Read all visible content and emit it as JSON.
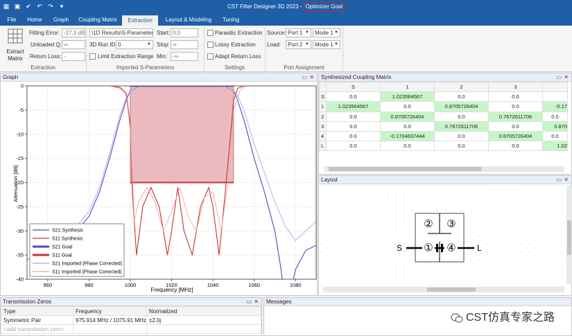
{
  "titlebar": {
    "title_main": "CST Filter Designer 3D 2023 - ",
    "title_goal": "Optimizer Goal"
  },
  "tabs": [
    "File",
    "Home",
    "Graph",
    "Coupling Matrix",
    "Extraction",
    "Layout & Modeling",
    "Tuning"
  ],
  "active_tab": "Extraction",
  "ribbon": {
    "extract_label_1": "Extract",
    "extract_label_2": "Matrix",
    "fitting_error_label": "Fitting Error:",
    "fitting_error_value": "-27.3 dB",
    "unloaded_q_label": "Unloaded Q:",
    "unloaded_q_value": "∞",
    "return_loss_label": "Return Loss:",
    "return_loss_value": "-",
    "group_extraction": "Extraction",
    "imported_path": "\\1D Results\\S-Parameters",
    "run_id_label": "3D Run ID:",
    "run_id_value": "0",
    "start_label": "Start:",
    "start_value": "0.0",
    "stop_label": "Stop:",
    "stop_value": "∞",
    "min_label": "Min:",
    "min_value": "-∞",
    "limit_range_label": "Limit Extraction Range",
    "group_imported": "Imported S-Parameters",
    "parasitic_label": "Parasitic Extraction",
    "lossy_label": "Lossy Extraction",
    "adapt_label": "Adapt Return Loss",
    "group_settings": "Settings",
    "source_label": "Source:",
    "source_port": "Port 1",
    "source_mode": "Mode 1",
    "load_label": "Load:",
    "load_port": "Port 2",
    "load_mode": "Mode 1",
    "group_ports": "Port Assignment"
  },
  "graph_panel": {
    "title": "Graph"
  },
  "coupling_panel": {
    "title": "Synthesized Coupling Matrix",
    "columns": [
      "S",
      "1",
      "2",
      "3"
    ],
    "rows": [
      {
        "label": "S",
        "cells": [
          "0.0",
          "1.023564567",
          "0.0",
          "0.0",
          ""
        ]
      },
      {
        "label": "1",
        "cells": [
          "1.023564567",
          "0.0",
          "0.8705726404",
          "0.0",
          "-0.17"
        ]
      },
      {
        "label": "2",
        "cells": [
          "0.0",
          "0.8705726404",
          "0.0",
          "0.7672611706",
          "0.0"
        ]
      },
      {
        "label": "3",
        "cells": [
          "0.0",
          "0.0",
          "0.7672611706",
          "0.0",
          "0.870"
        ]
      },
      {
        "label": "4",
        "cells": [
          "0.0",
          "-0.1704637444",
          "0.0",
          "0.8705726404",
          "0.0"
        ]
      },
      {
        "label": "L",
        "cells": [
          "0.0",
          "0.0",
          "0.0",
          "0.0",
          "1.02"
        ]
      }
    ]
  },
  "layout_panel": {
    "title": "Layout",
    "node_s": "S",
    "node_l": "L",
    "res_1": "①",
    "res_2": "②",
    "res_3": "③",
    "res_4": "④"
  },
  "tz_panel": {
    "title": "Transmission Zeros",
    "headers": [
      "Type",
      "Frequency",
      "Normalized"
    ],
    "row": [
      "Symmetric Pair",
      "975.914 MHz / 1075.91 MHz",
      "±2.0j"
    ],
    "add_placeholder": "<add transmission zero>"
  },
  "messages_panel": {
    "title": "Messages"
  },
  "watermark": "CST仿真专家之路",
  "chart_data": {
    "type": "line",
    "title": "",
    "xlabel": "Frequency [MHz]",
    "ylabel": "Attenuation [dB]",
    "xlim": [
      950,
      1090
    ],
    "ylim": [
      -40,
      0
    ],
    "x_ticks": [
      960,
      980,
      1000,
      1020,
      1040,
      1060,
      1080
    ],
    "y_ticks": [
      0,
      -5,
      -10,
      -15,
      -20,
      -25,
      -30,
      -35,
      -40
    ],
    "grid": true,
    "legend_position": "bottom-left",
    "goal_box": {
      "x_start": 1000,
      "x_end": 1050,
      "y_top": 0,
      "y_bottom": -20
    },
    "series": [
      {
        "name": "S21 Synthesis",
        "color": "#4a4ac8",
        "x": [
          950,
          970,
          980,
          985,
          990,
          995,
          998,
          1000,
          1005,
          1025,
          1045,
          1050,
          1052,
          1055,
          1060,
          1065,
          1070,
          1073,
          1075,
          1076,
          1078,
          1080,
          1085,
          1090
        ],
        "y": [
          -36,
          -32,
          -27,
          -22,
          -15,
          -7,
          -3,
          -1,
          0,
          0,
          0,
          -1,
          -3,
          -7,
          -15,
          -22,
          -30,
          -38,
          -45,
          -45,
          -42,
          -38,
          -34,
          -33
        ]
      },
      {
        "name": "S11 Synthesis",
        "color": "#c83232",
        "x": [
          950,
          990,
          995,
          998,
          1000,
          1001,
          1003,
          1006,
          1010,
          1014,
          1018,
          1020,
          1023,
          1026,
          1030,
          1034,
          1038,
          1040,
          1043,
          1046,
          1049,
          1050,
          1052,
          1055,
          1060,
          1090
        ],
        "y": [
          0,
          0,
          -0.3,
          -1.5,
          -8,
          -22,
          -35,
          -25,
          -21,
          -25,
          -35,
          -30,
          -21,
          -30,
          -35,
          -25,
          -21,
          -25,
          -35,
          -22,
          -8,
          -3,
          -0.5,
          0,
          0,
          0
        ]
      },
      {
        "name": "S21 Goal",
        "color": "#4a4ac8",
        "y_level": 0
      },
      {
        "name": "S11 Goal",
        "color": "#c83232",
        "y_level": -20
      },
      {
        "name": "S21 Imported (Phase Corrected)",
        "color": "#a8a8e8",
        "x": [
          950,
          970,
          980,
          985,
          990,
          995,
          998,
          1000,
          1005,
          1025,
          1045,
          1050,
          1052,
          1055,
          1060,
          1065,
          1070,
          1075,
          1080,
          1085,
          1090
        ],
        "y": [
          -36,
          -31,
          -26,
          -21,
          -14,
          -6,
          -2.5,
          -1,
          0,
          0,
          0,
          -1,
          -2,
          -5,
          -12,
          -18,
          -24,
          -29,
          -32,
          -30,
          -28
        ]
      },
      {
        "name": "S11 Imported (Phase Corrected)",
        "color": "#e8a8a8",
        "x": [
          950,
          990,
          995,
          998,
          1000,
          1002,
          1004,
          1008,
          1012,
          1016,
          1020,
          1024,
          1028,
          1032,
          1036,
          1040,
          1044,
          1048,
          1050,
          1053,
          1056,
          1060,
          1090
        ],
        "y": [
          0,
          0,
          -0.5,
          -2,
          -9,
          -28,
          -24,
          -21,
          -24,
          -30,
          -26,
          -21,
          -27,
          -30,
          -23,
          -22,
          -30,
          -18,
          -5,
          -1,
          0,
          0,
          0
        ]
      }
    ]
  }
}
